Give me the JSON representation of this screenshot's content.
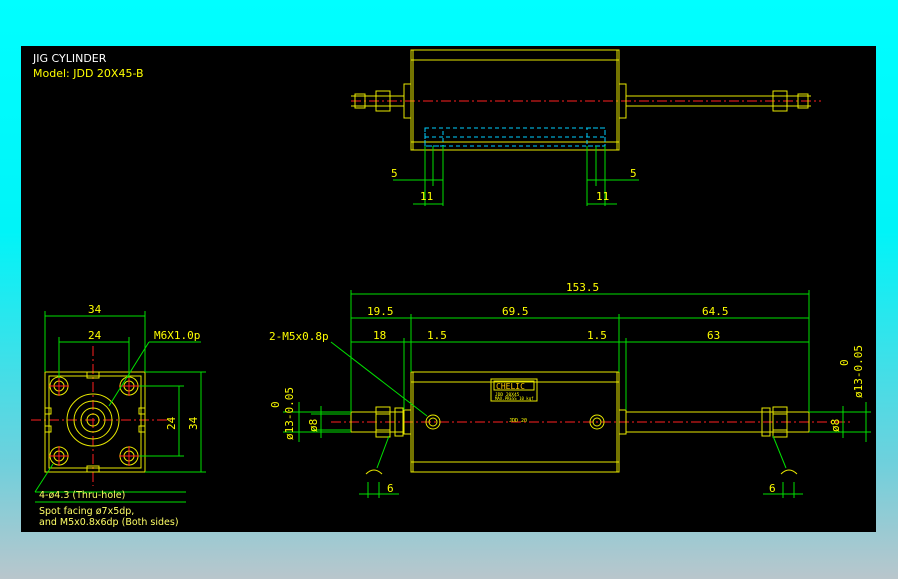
{
  "header": {
    "title": "JIG CYLINDER",
    "model": "Model:  JDD 20X45-B"
  },
  "top_view": {
    "dim_left_small": "5",
    "dim_left_large": "11",
    "dim_right_small": "5",
    "dim_right_large": "11"
  },
  "end_view": {
    "dim_width": "34",
    "dim_hole_pitch": "24",
    "dim_height": "34",
    "dim_vert_pitch": "24",
    "thread_label": "M6X1.0p",
    "hole_label": "4-ø4.3 (Thru-hole)",
    "note_line1": "Spot facing ø7x5dp,",
    "note_line2": "and M5x0.8x6dp (Both sides)"
  },
  "front_view": {
    "dim_overall": "153.5",
    "dim_19_5": "19.5",
    "dim_69_5": "69.5",
    "dim_64_5": "64.5",
    "dim_18": "18",
    "dim_1_5_left": "1.5",
    "dim_1_5_right": "1.5",
    "dim_63": "63",
    "port_label": "2-M5x0.8p",
    "rod_dia_left": "ø13-0.05",
    "rod_tol_left": "0",
    "rod_dia_right": "ø13-0.05",
    "rod_tol_right": "0",
    "thread_dia_left": "ø8",
    "thread_dia_right": "ø8",
    "dim_6_left": "6",
    "dim_6_right": "6",
    "brand": "CHELIC",
    "plate_line1": "JDD 20X45",
    "plate_line2": "MAX.PRESS 10 kgf",
    "body_mark": "JDD 20"
  },
  "colors": {
    "outline": "#e8e800",
    "dimension": "#00e000",
    "centerline": "#ff2020",
    "hidden": "#00d0ff",
    "background": "#000000"
  }
}
